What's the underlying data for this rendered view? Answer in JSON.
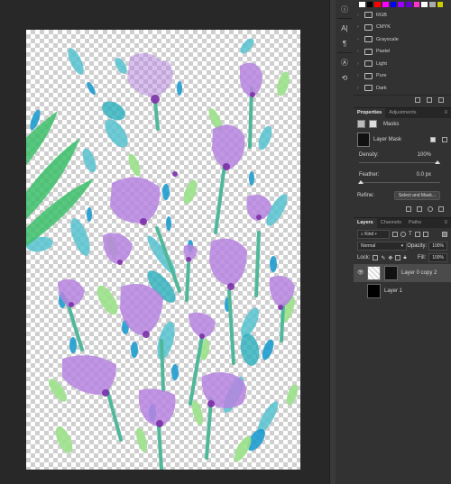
{
  "swatches": {
    "colors": [
      "#ffffff",
      "#000000",
      "#ff0000",
      "#ff00ff",
      "#0000ff",
      "#9900ff",
      "#6600cc",
      "#ff33cc",
      "#ffffff",
      "#aaaaaa",
      "#cccc00",
      "#333333"
    ],
    "folders": [
      {
        "label": "RGB"
      },
      {
        "label": "CMYK"
      },
      {
        "label": "Grayscale"
      },
      {
        "label": "Pastel"
      },
      {
        "label": "Light"
      },
      {
        "label": "Pure"
      },
      {
        "label": "Dark"
      }
    ]
  },
  "properties": {
    "tabs": [
      "Properties",
      "Adjustments"
    ],
    "section_label": "Masks",
    "mask_label": "Layer Mask",
    "density_label": "Density:",
    "density_value": "100%",
    "feather_label": "Feather:",
    "feather_value": "0.0 px",
    "refine_label": "Refine:",
    "select_mask_button": "Select and Mask..."
  },
  "layers": {
    "tabs": [
      "Layers",
      "Channels",
      "Paths"
    ],
    "filter_kind": "Kind",
    "blend_mode": "Normal",
    "opacity_label": "Opacity:",
    "opacity_value": "100%",
    "lock_label": "Lock:",
    "fill_label": "Fill:",
    "fill_value": "100%",
    "items": [
      {
        "name": "Layer 0 copy 2",
        "selected": true
      },
      {
        "name": "Layer 1",
        "selected": false
      }
    ]
  },
  "icons": {
    "tools": [
      "info-icon",
      "character-icon",
      "paragraph-icon",
      "glyphs-icon",
      "history-icon"
    ]
  }
}
